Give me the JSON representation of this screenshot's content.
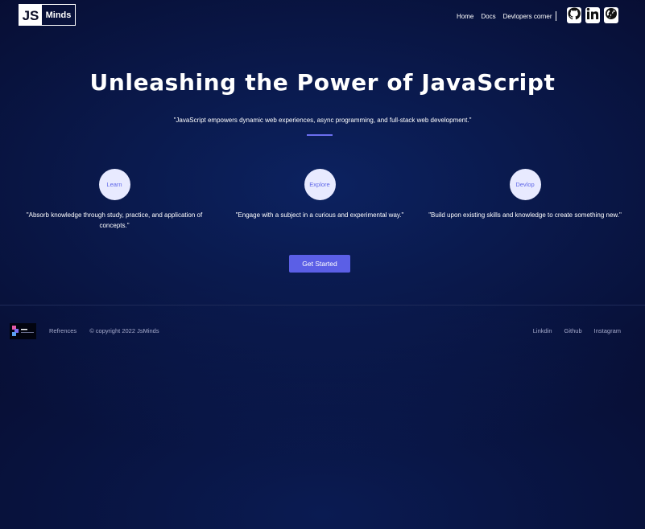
{
  "header": {
    "logo": {
      "js": "JS",
      "name": "Minds"
    },
    "nav": [
      {
        "label": "Home"
      },
      {
        "label": "Docs"
      },
      {
        "label": "Devlopers corner"
      }
    ],
    "social": [
      {
        "icon": "github-icon"
      },
      {
        "icon": "linkedin-icon"
      },
      {
        "icon": "globe-icon"
      }
    ]
  },
  "hero": {
    "title": "Unleashing the Power of JavaScript",
    "quote": "\"JavaScript empowers dynamic web experiences, async programming, and full-stack web development.\""
  },
  "features": [
    {
      "label": "Learn",
      "text": "\"Absorb knowledge through study, practice, and application of concepts.\""
    },
    {
      "label": "Explore",
      "text": "\"Engage with a subject in a curious and experimental way.\""
    },
    {
      "label": "Devlop",
      "text": "\"Build upon existing skills and knowledge to create something new.\""
    }
  ],
  "cta": {
    "label": "Get Started"
  },
  "footer": {
    "left_links": [
      {
        "label": "Refrences"
      }
    ],
    "copyright": "© copyright 2022 JsMinds",
    "right_links": [
      {
        "label": "Linkdin"
      },
      {
        "label": "Github"
      },
      {
        "label": "Instagram"
      }
    ]
  },
  "colors": {
    "background": "#070d31",
    "accent": "#5b5fe6",
    "feature_circle": "#e8eaff"
  }
}
